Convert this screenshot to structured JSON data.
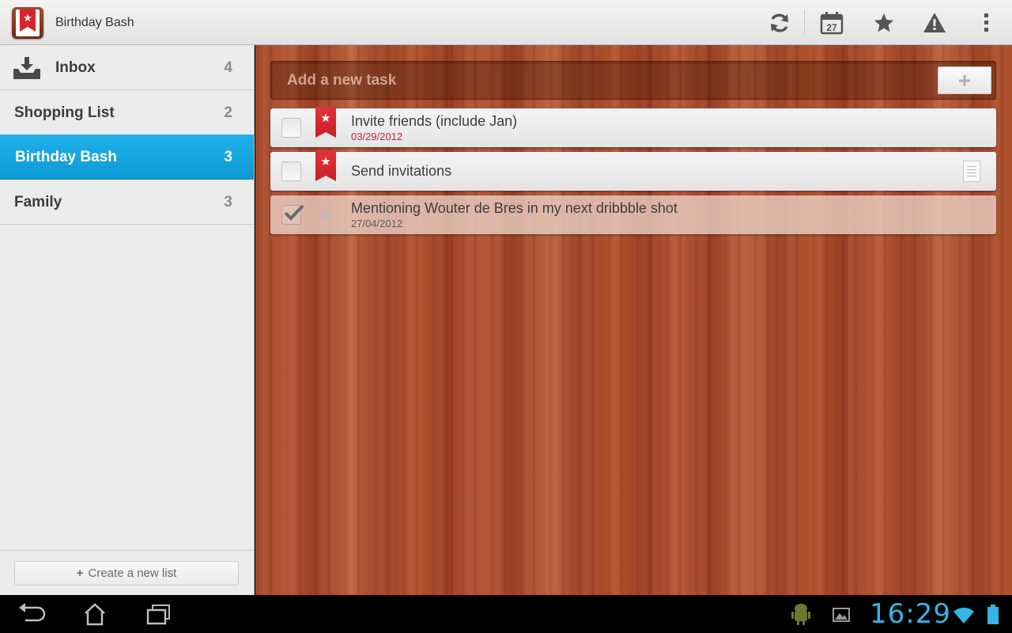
{
  "app": {
    "title": "Birthday Bash",
    "icon": "wunderlist-icon"
  },
  "actions": [
    {
      "name": "sync-icon"
    },
    {
      "name": "calendar-icon",
      "label": "27"
    },
    {
      "name": "star-icon"
    },
    {
      "name": "alert-icon"
    },
    {
      "name": "overflow-menu-icon"
    }
  ],
  "sidebar": {
    "items": [
      {
        "label": "Inbox",
        "count": "4",
        "icon": "inbox-icon"
      },
      {
        "label": "Shopping List",
        "count": "2"
      },
      {
        "label": "Birthday Bash",
        "count": "3",
        "active": true
      },
      {
        "label": "Family",
        "count": "3"
      }
    ],
    "create_label": "Create a new list",
    "create_icon": "plus-icon"
  },
  "add_task": {
    "placeholder": "Add a new task",
    "button_label": "+"
  },
  "tasks": [
    {
      "title": "Invite friends (include Jan)",
      "date": "03/29/2012",
      "date_color": "#d0212a",
      "starred": true,
      "done": false
    },
    {
      "title": "Send invitations",
      "starred": true,
      "done": false,
      "has_note": true
    },
    {
      "title": "Mentioning Wouter de Bres in my next dribbble shot",
      "date": "27/04/2012",
      "date_color": "#6a5a55",
      "starred": false,
      "done": true
    }
  ],
  "system_bar": {
    "time": "16:29",
    "clock_color": "#33b5e5",
    "icons": [
      "back-icon",
      "home-icon",
      "recent-apps-icon",
      "android-debug-icon",
      "gallery-icon",
      "wifi-icon",
      "battery-icon"
    ]
  }
}
